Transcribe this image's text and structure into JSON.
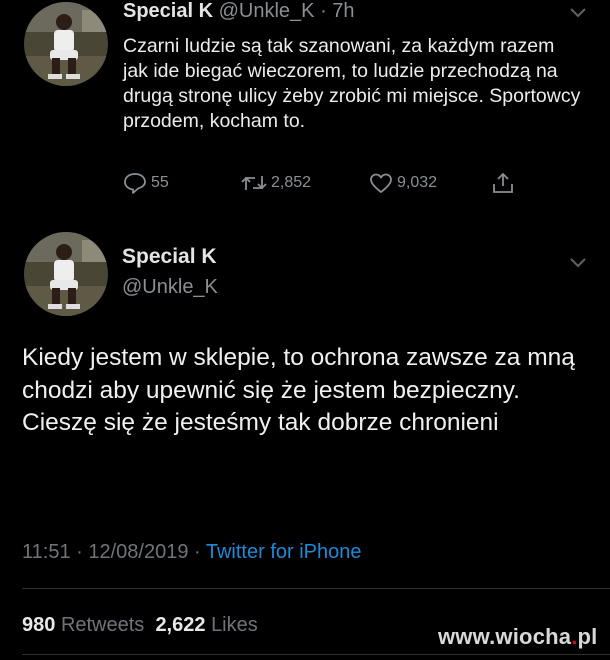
{
  "tweet1": {
    "name": "Special K",
    "handle": "@Unkle_K",
    "time": "· 7h",
    "text": "Czarni ludzie są tak szanowani, za każdym razem jak ide biegać wieczorem, to ludzie przechodzą na drugą stronę ulicy żeby zrobić mi miejsce. Sportowcy przodem, kocham to.",
    "replies": "55",
    "retweets": "2,852",
    "likes": "9,032"
  },
  "tweet2": {
    "name": "Special K",
    "handle": "@Unkle_K",
    "text": "Kiedy jestem w sklepie, to ochrona zawsze za mną chodzi aby upewnić się że jestem bezpieczny. Cieszę się że jesteśmy tak dobrze chronieni",
    "time": "11:51 · 12/08/2019 ·",
    "source": "Twitter for iPhone",
    "retweet_count": "980",
    "retweet_label": "Retweets",
    "like_count": "2,622",
    "like_label": "Likes"
  },
  "watermark": {
    "before_dot": "www.wiocha",
    "dot": ".",
    "after_dot": "pl"
  },
  "icons": {
    "reply": "reply-icon",
    "retweet": "retweet-icon",
    "like": "heart-icon",
    "share": "share-icon",
    "more": "chevron-down-icon"
  },
  "colors": {
    "background": "#000000",
    "link": "#1d8ad8",
    "muted": "#8a8f94"
  }
}
